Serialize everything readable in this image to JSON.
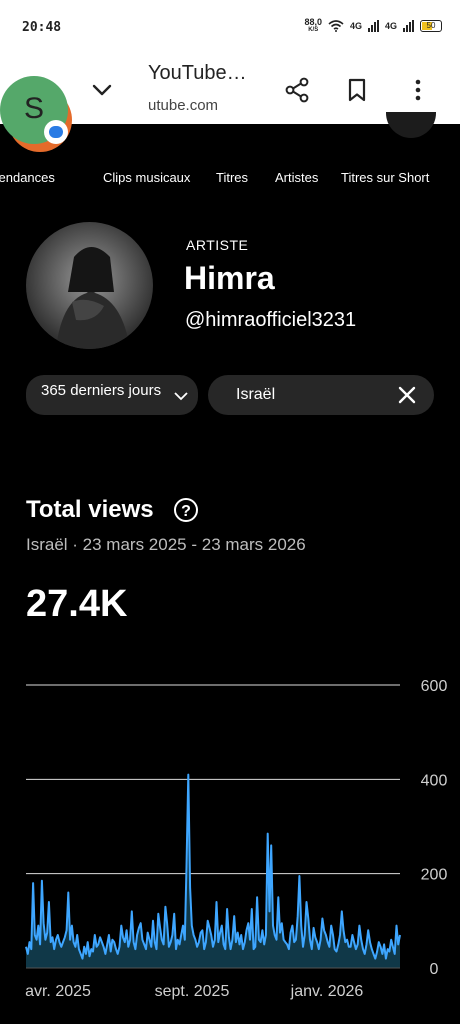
{
  "status_bar": {
    "time": "20:48",
    "speed": "88,0",
    "speed_unit": "K/S",
    "net1": "4G",
    "net2": "4G",
    "battery": "50"
  },
  "browser": {
    "title": "YouTube…",
    "url": "utube.com",
    "avatar_letter": "S"
  },
  "tabs": [
    "Tendances",
    "Clips musicaux",
    "Titres",
    "Artistes",
    "Titres sur Short"
  ],
  "artist": {
    "kicker": "ARTISTE",
    "name": "Himra",
    "handle": "@himraofficiel3231"
  },
  "filters": {
    "period": "365 derniers jours",
    "country": "Israël"
  },
  "total": {
    "title": "Total views",
    "range": "Israël · 23 mars 2025 - 23 mars 2026",
    "value": "27.4K"
  },
  "chart_data": {
    "type": "area",
    "x_tick_labels": [
      "avr. 2025",
      "sept. 2025",
      "janv. 2026"
    ],
    "y_ticks": [
      0,
      200,
      400,
      600
    ],
    "ylim": [
      0,
      600
    ],
    "x_range": [
      "2025-03-23",
      "2026-03-23"
    ],
    "grid": true,
    "line_color": "#3ea6ff",
    "fill_color": "#103848",
    "values": [
      45,
      30,
      55,
      40,
      180,
      70,
      60,
      90,
      50,
      185,
      95,
      60,
      75,
      140,
      55,
      65,
      40,
      60,
      70,
      55,
      45,
      55,
      65,
      80,
      160,
      60,
      90,
      55,
      45,
      70,
      40,
      30,
      20,
      45,
      30,
      55,
      25,
      40,
      35,
      70,
      45,
      50,
      65,
      55,
      45,
      30,
      50,
      70,
      35,
      60,
      55,
      40,
      30,
      45,
      90,
      65,
      55,
      80,
      45,
      60,
      120,
      55,
      40,
      70,
      85,
      95,
      60,
      50,
      40,
      75,
      60,
      45,
      100,
      55,
      40,
      115,
      85,
      60,
      50,
      130,
      95,
      45,
      55,
      70,
      115,
      40,
      60,
      50,
      70,
      90,
      60,
      215,
      410,
      170,
      90,
      70,
      60,
      45,
      55,
      75,
      80,
      40,
      55,
      100,
      85,
      70,
      45,
      60,
      140,
      55,
      75,
      90,
      50,
      40,
      125,
      65,
      40,
      60,
      110,
      55,
      75,
      50,
      70,
      40,
      55,
      80,
      95,
      60,
      125,
      40,
      45,
      150,
      60,
      55,
      80,
      50,
      70,
      285,
      120,
      260,
      90,
      70,
      60,
      150,
      75,
      95,
      60,
      55,
      50,
      40,
      75,
      90,
      55,
      60,
      110,
      195,
      90,
      45,
      70,
      140,
      105,
      60,
      40,
      85,
      65,
      55,
      40,
      60,
      105,
      80,
      70,
      55,
      45,
      90,
      70,
      40,
      35,
      50,
      70,
      120,
      80,
      55,
      60,
      45,
      45,
      70,
      55,
      40,
      50,
      90,
      60,
      40,
      30,
      50,
      80,
      55,
      40,
      30,
      20,
      35,
      55,
      45,
      30,
      50,
      20,
      40,
      35,
      60,
      45,
      30,
      90,
      50,
      70
    ]
  }
}
